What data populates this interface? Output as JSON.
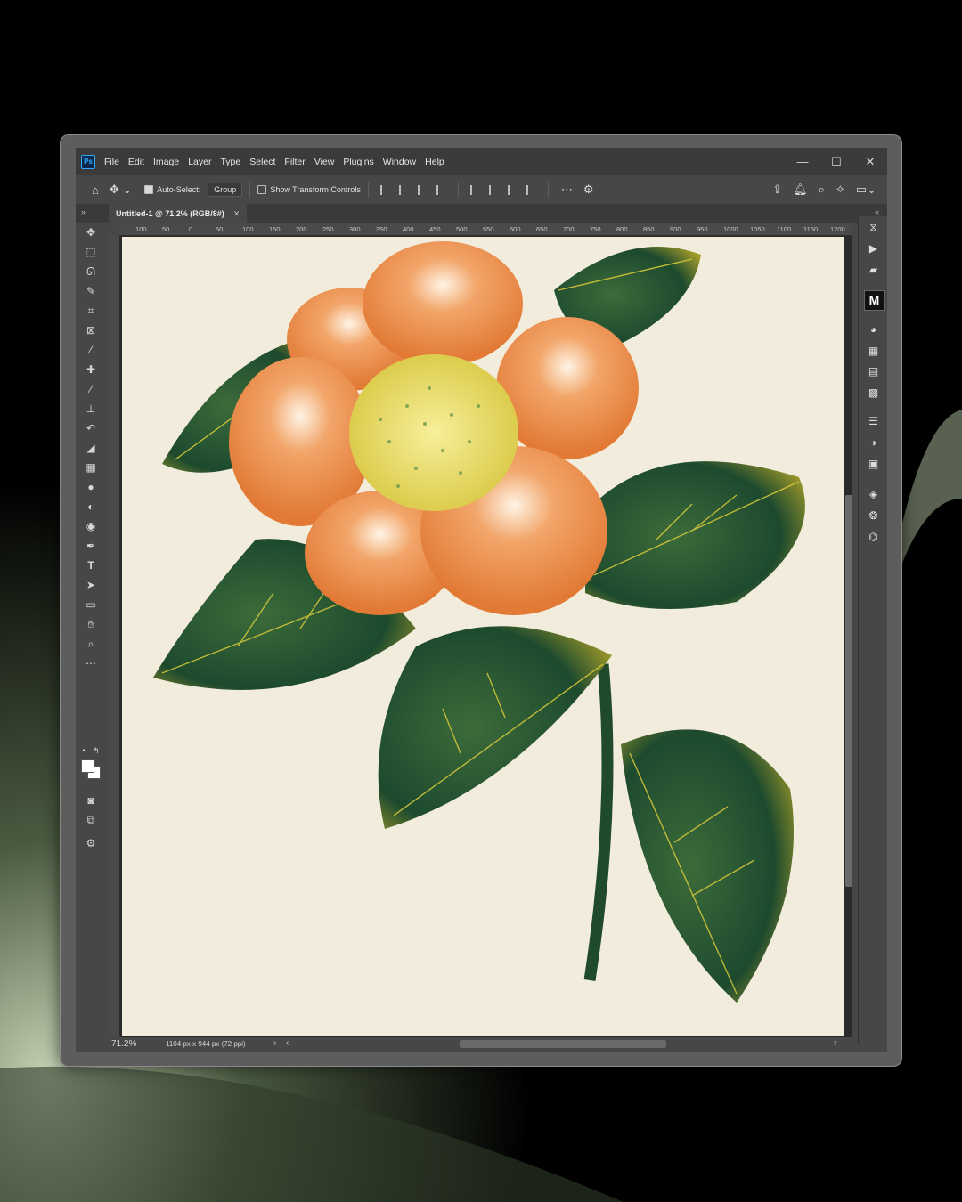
{
  "app": {
    "menus": [
      "File",
      "Edit",
      "Image",
      "Layer",
      "Type",
      "Select",
      "Filter",
      "View",
      "Plugins",
      "Window",
      "Help"
    ],
    "window_controls": {
      "minimize": "—",
      "maximize": "☐",
      "close": "✕"
    }
  },
  "options_bar": {
    "auto_select_label": "Auto-Select:",
    "auto_select_checked": true,
    "group_value": "Group",
    "transform_label": "Show Transform Controls",
    "transform_checked": false
  },
  "document": {
    "tab_title": "Untitled-1 @ 71.2% (RGB/8#)",
    "zoom": "71.2%",
    "info": "1104 px x 944 px (72 ppi)"
  },
  "ruler_ticks": [
    "100",
    "50",
    "0",
    "50",
    "100",
    "150",
    "200",
    "250",
    "300",
    "350",
    "400",
    "450",
    "500",
    "550",
    "600",
    "650",
    "700",
    "750",
    "800",
    "850",
    "900",
    "950",
    "1000",
    "1050",
    "1100",
    "1150",
    "1200"
  ],
  "tools": [
    "move-tool",
    "marquee-tool",
    "lasso-tool",
    "quick-selection-tool",
    "crop-tool",
    "frame-tool",
    "eyedropper-tool",
    "healing-brush-tool",
    "brush-tool",
    "clone-stamp-tool",
    "history-brush-tool",
    "eraser-tool",
    "gradient-tool",
    "blur-tool",
    "dodge-tool",
    "sponge-tool",
    "pen-tool",
    "type-tool",
    "path-selection-tool",
    "rectangle-tool",
    "hand-tool",
    "zoom-tool",
    "more-tools"
  ],
  "colors": {
    "canvas": "#f2ecdc",
    "petal": "#e88a45",
    "leaf": "#1f4a2c",
    "leaf_vein": "#d8c93a",
    "center": "#e6dc6a"
  }
}
